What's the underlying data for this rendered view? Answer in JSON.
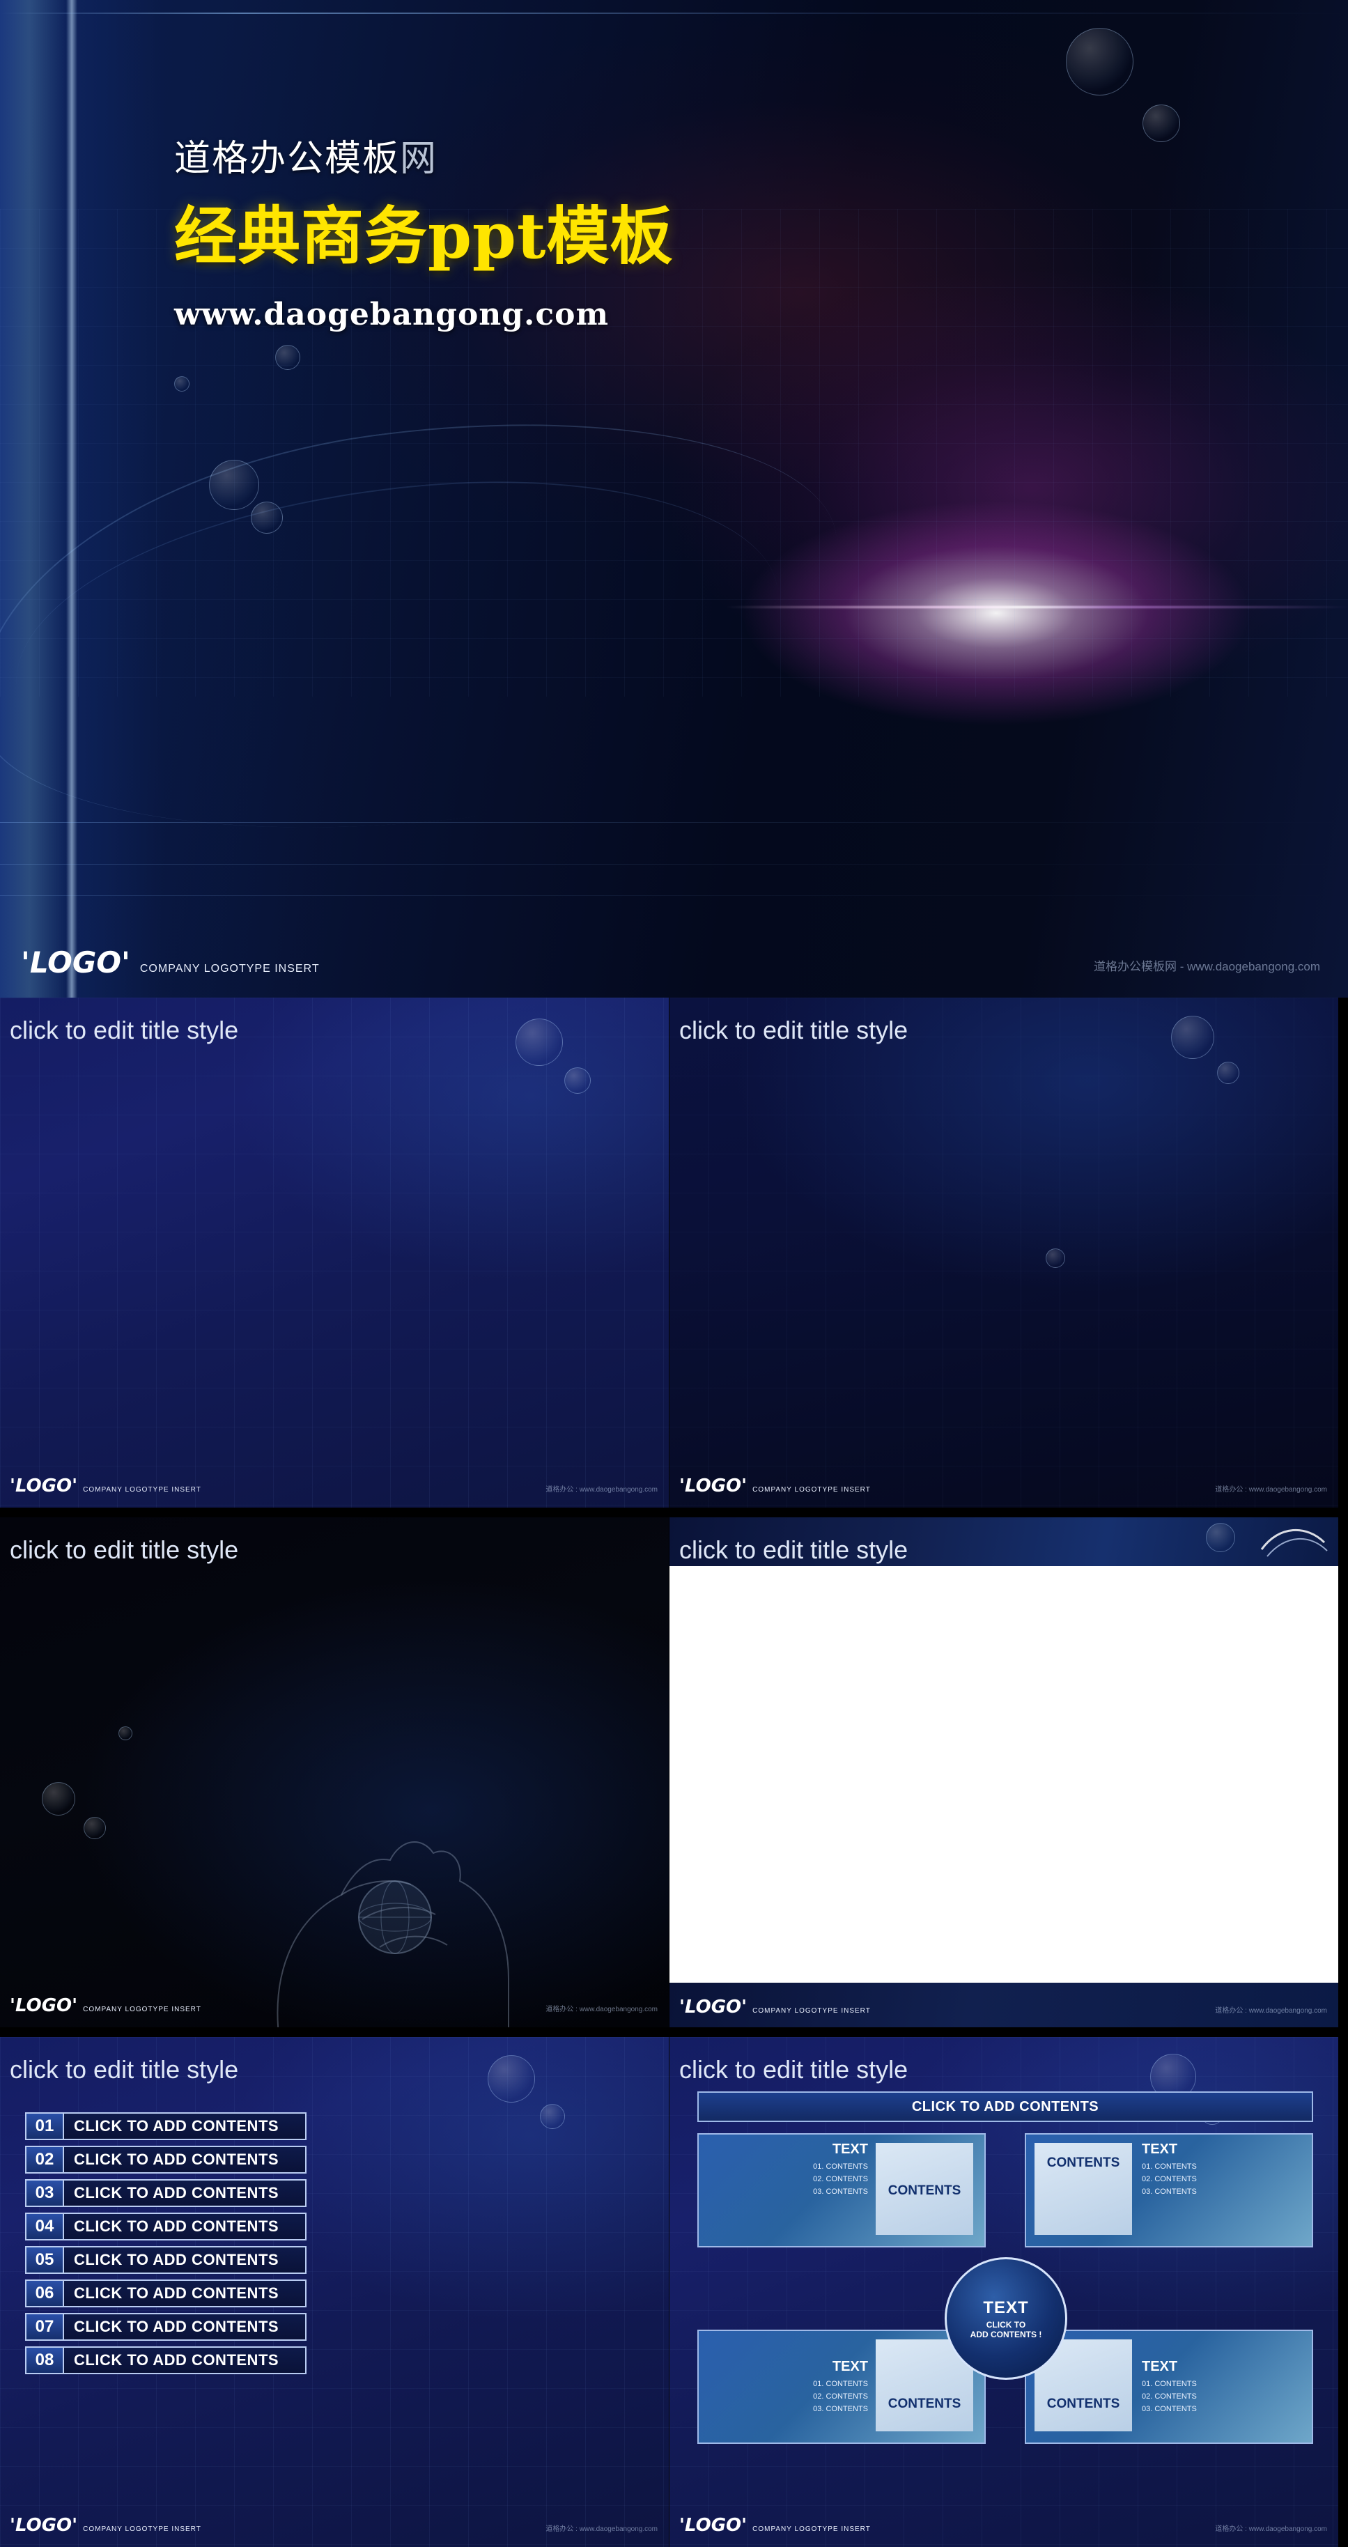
{
  "cover": {
    "subtitle_cn": "道格办公模板",
    "subtitle_cn_grey": "网",
    "title_cn": "经典商务ppt模板",
    "url": "www.daogebangong.com",
    "logo_word": "'LOGO'",
    "logo_company": "COMPANY LOGOTYPE INSERT",
    "watermark": "道格办公模板网 - www.daogebangong.com"
  },
  "common": {
    "title_placeholder": "click to edit title style",
    "logo_word": "'LOGO'",
    "logo_company": "COMPANY LOGOTYPE INSERT",
    "watermark_short": "道格办公 : www.daogebangong.com",
    "watermark_long": "道格办公 : www.daogebangong.com"
  },
  "slides": [
    {
      "name": "slide-blank-blue",
      "title": "click to edit title style"
    },
    {
      "name": "slide-blank-navy",
      "title": "click to edit title style"
    },
    {
      "name": "slide-hand-globe",
      "title": "click to edit title style"
    },
    {
      "name": "slide-white-content",
      "title": "click to edit title style"
    },
    {
      "name": "slide-numbered-list",
      "title": "click to edit title style"
    },
    {
      "name": "slide-diagram",
      "title": "click to edit title style"
    }
  ],
  "list_slide": {
    "items": [
      {
        "num": "01",
        "label": "CLICK TO ADD CONTENTS"
      },
      {
        "num": "02",
        "label": "CLICK TO ADD CONTENTS"
      },
      {
        "num": "03",
        "label": "CLICK TO ADD CONTENTS"
      },
      {
        "num": "04",
        "label": "CLICK TO ADD CONTENTS"
      },
      {
        "num": "05",
        "label": "CLICK TO ADD CONTENTS"
      },
      {
        "num": "06",
        "label": "CLICK TO ADD CONTENTS"
      },
      {
        "num": "07",
        "label": "CLICK TO ADD CONTENTS"
      },
      {
        "num": "08",
        "label": "CLICK TO ADD CONTENTS"
      }
    ]
  },
  "diagram_slide": {
    "header": "CLICK TO ADD CONTENTS",
    "center": {
      "line1": "TEXT",
      "line2": "CLICK TO",
      "line3": "ADD CONTENTS !"
    },
    "quadrants": [
      {
        "name": "top-left",
        "text_label": "TEXT",
        "bullets": [
          "01. CONTENTS",
          "02. CONTENTS",
          "03. CONTENTS"
        ],
        "contents_label": "CONTENTS"
      },
      {
        "name": "top-right",
        "text_label": "TEXT",
        "bullets": [
          "01. CONTENTS",
          "02. CONTENTS",
          "03. CONTENTS"
        ],
        "contents_label": "CONTENTS"
      },
      {
        "name": "bottom-left",
        "text_label": "TEXT",
        "bullets": [
          "01. CONTENTS",
          "02. CONTENTS",
          "03. CONTENTS"
        ],
        "contents_label": "CONTENTS"
      },
      {
        "name": "bottom-right",
        "text_label": "TEXT",
        "bullets": [
          "01. CONTENTS",
          "02. CONTENTS",
          "03. CONTENTS"
        ],
        "contents_label": "CONTENTS"
      }
    ]
  },
  "colors": {
    "accent_yellow": "#ffe500",
    "deep_blue": "#11204f",
    "light_blue_border": "#b9ccf2",
    "title_text": "#dfe7f7"
  }
}
